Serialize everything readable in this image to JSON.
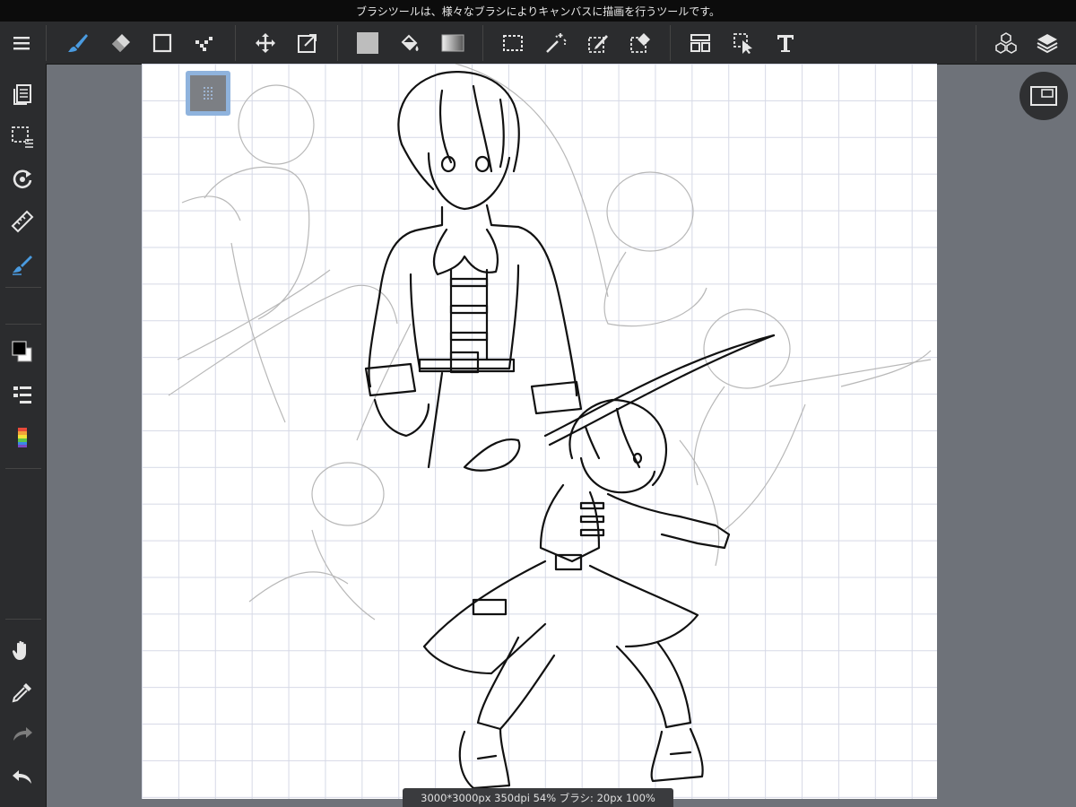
{
  "tip": "ブラシツールは、様々なブラシによりキャンバスに描画を行うツールです。",
  "status": "3000*3000px 350dpi 54% ブラシ: 20px 100%",
  "toolbar": {
    "menu": "menu-icon",
    "tools": [
      "brush-icon",
      "eraser-icon",
      "shape-icon",
      "dot-icon",
      "move-icon",
      "transform-icon",
      "fill-color-icon",
      "bucket-icon",
      "gradient-icon",
      "select-rect-icon",
      "magic-wand-icon",
      "select-pen-icon",
      "select-eraser-icon",
      "layout-icon",
      "select-move-icon",
      "text-icon"
    ],
    "right": [
      "3d-material-icon",
      "layers-icon"
    ]
  },
  "sidebar": {
    "items": [
      "pages-icon",
      "selection-icon",
      "rotate-icon",
      "ruler-icon",
      "snap-brush-icon",
      "color-swatch-icon",
      "brush-list-icon",
      "palette-icon",
      "hand-icon",
      "eyedropper-icon",
      "redo-icon",
      "undo-icon"
    ]
  },
  "colors": {
    "accent": "#4a9be0",
    "foreground": "#000000",
    "background": "#ffffff",
    "sketch": "#b8b8b8"
  }
}
